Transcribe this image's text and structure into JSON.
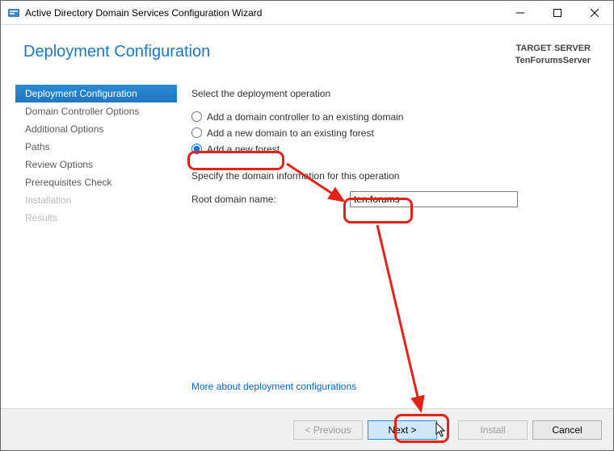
{
  "window": {
    "title": "Active Directory Domain Services Configuration Wizard"
  },
  "header": {
    "page_title": "Deployment Configuration",
    "target_label": "TARGET SERVER",
    "target_name": "TenForumsServer"
  },
  "sidebar": {
    "items": [
      {
        "label": "Deployment Configuration",
        "state": "active"
      },
      {
        "label": "Domain Controller Options",
        "state": "normal"
      },
      {
        "label": "Additional Options",
        "state": "normal"
      },
      {
        "label": "Paths",
        "state": "normal"
      },
      {
        "label": "Review Options",
        "state": "normal"
      },
      {
        "label": "Prerequisites Check",
        "state": "normal"
      },
      {
        "label": "Installation",
        "state": "disabled"
      },
      {
        "label": "Results",
        "state": "disabled"
      }
    ]
  },
  "content": {
    "operation_heading": "Select the deployment operation",
    "radios": [
      {
        "label": "Add a domain controller to an existing domain",
        "checked": false
      },
      {
        "label": "Add a new domain to an existing forest",
        "checked": false
      },
      {
        "label": "Add a new forest",
        "checked": true
      }
    ],
    "spec_heading": "Specify the domain information for this operation",
    "root_domain_label": "Root domain name:",
    "root_domain_value": "ten.forums",
    "more_link": "More about deployment configurations"
  },
  "footer": {
    "previous": "< Previous",
    "next": "Next >",
    "install": "Install",
    "cancel": "Cancel"
  },
  "annotations": {
    "highlight_color": "#e2231a"
  }
}
